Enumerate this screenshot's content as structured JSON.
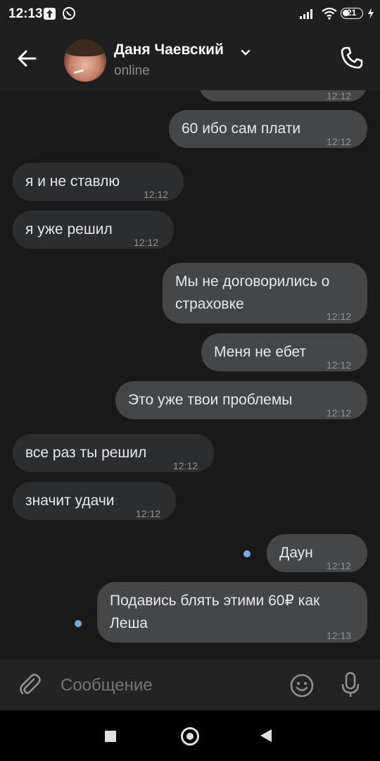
{
  "status_bar": {
    "time": "12:13",
    "battery": "21"
  },
  "header": {
    "name": "Даня Чаевский",
    "status": "online"
  },
  "messages": [
    {
      "id": "m0",
      "direction": "out",
      "text": "",
      "time": "12:12"
    },
    {
      "id": "m1",
      "direction": "out",
      "text": "60 ибо сам плати",
      "time": "12:12"
    },
    {
      "id": "m2",
      "direction": "in",
      "text": "я и не ставлю",
      "time": "12:12"
    },
    {
      "id": "m3",
      "direction": "in",
      "text": "я уже решил",
      "time": "12:12"
    },
    {
      "id": "m4",
      "direction": "out",
      "text": "Мы не договорились о\nстраховке",
      "time": "12:12"
    },
    {
      "id": "m5",
      "direction": "out",
      "text": "Меня не ебет",
      "time": "12:12"
    },
    {
      "id": "m6",
      "direction": "out",
      "text": "Это уже твои проблемы",
      "time": "12:12"
    },
    {
      "id": "m7",
      "direction": "in",
      "text": "все раз ты решил",
      "time": "12:12"
    },
    {
      "id": "m8",
      "direction": "in",
      "text": "значит удачи",
      "time": "12:12"
    },
    {
      "id": "m9",
      "direction": "out",
      "text": "Даун",
      "time": "12:12",
      "unread": true
    },
    {
      "id": "m10",
      "direction": "out",
      "text": "Подавись блять этими 60₽ как\nЛеша",
      "time": "12:13",
      "unread": true
    }
  ],
  "composer": {
    "placeholder": "Сообщение"
  },
  "icons": {
    "back": "arrow-left-icon",
    "call": "phone-icon",
    "attach": "paperclip-icon",
    "emoji": "smile-icon",
    "voice": "microphone-icon"
  },
  "colors": {
    "unread_dot": "#7ba8dd",
    "outgoing_bubble": "#454647",
    "incoming_bubble": "#2c2d2e"
  }
}
